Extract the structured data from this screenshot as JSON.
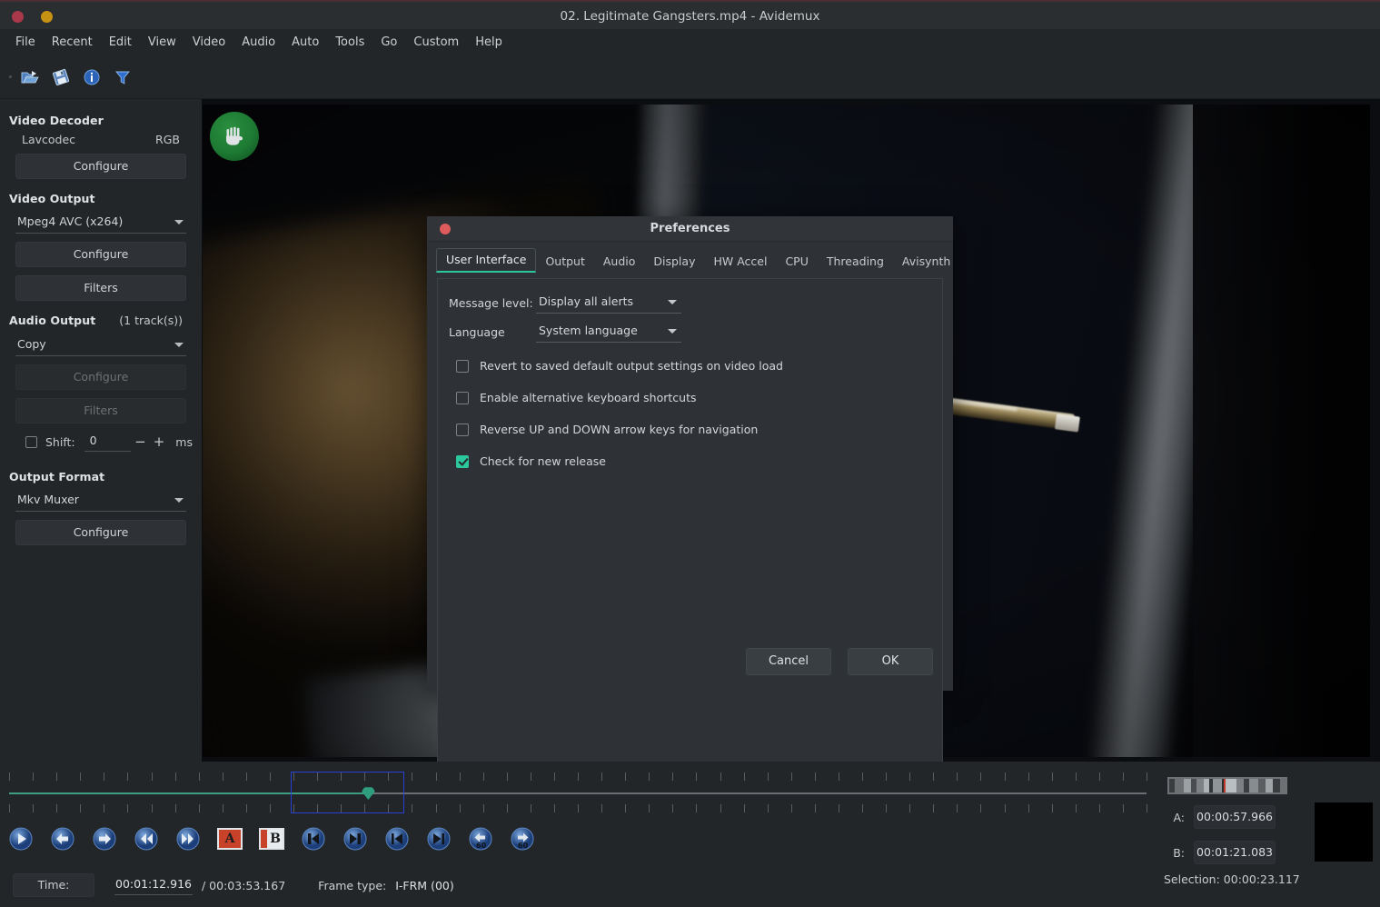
{
  "window": {
    "title": "02. Legitimate Gangsters.mp4 - Avidemux",
    "close_label": "close",
    "minimize_label": "minimize"
  },
  "menubar": {
    "items": [
      {
        "label": "File"
      },
      {
        "label": "Recent"
      },
      {
        "label": "Edit"
      },
      {
        "label": "View"
      },
      {
        "label": "Video"
      },
      {
        "label": "Audio"
      },
      {
        "label": "Auto"
      },
      {
        "label": "Tools"
      },
      {
        "label": "Go"
      },
      {
        "label": "Custom"
      },
      {
        "label": "Help"
      }
    ]
  },
  "toolbar": {
    "items": [
      {
        "icon": "open-file-icon"
      },
      {
        "icon": "save-file-icon"
      },
      {
        "icon": "info-icon"
      },
      {
        "icon": "filters-icon"
      }
    ]
  },
  "sidebar": {
    "video_decoder": {
      "title": "Video Decoder",
      "codec": "Lavcodec",
      "colorspace": "RGB",
      "configure_label": "Configure"
    },
    "video_output": {
      "title": "Video Output",
      "encoder": "Mpeg4 AVC (x264)",
      "configure_label": "Configure",
      "filters_label": "Filters"
    },
    "audio_output": {
      "title": "Audio Output",
      "tracks": "(1 track(s))",
      "codec": "Copy",
      "configure_label": "Configure",
      "filters_label": "Filters",
      "shift_label": "Shift:",
      "shift_value": "0",
      "shift_minus": "−",
      "shift_plus": "+",
      "shift_unit": "ms"
    },
    "output_format": {
      "title": "Output Format",
      "muxer": "Mkv Muxer",
      "configure_label": "Configure"
    }
  },
  "preferences": {
    "title": "Preferences",
    "tabs": [
      {
        "label": "User Interface",
        "active": true
      },
      {
        "label": "Output",
        "active": false
      },
      {
        "label": "Audio",
        "active": false
      },
      {
        "label": "Display",
        "active": false
      },
      {
        "label": "HW Accel",
        "active": false
      },
      {
        "label": "CPU",
        "active": false
      },
      {
        "label": "Threading",
        "active": false
      },
      {
        "label": "Avisynth",
        "active": false
      }
    ],
    "fields": {
      "message_level_label": "Message level:",
      "message_level_value": "Display all alerts",
      "language_label": "Language",
      "language_value": "System language"
    },
    "checkboxes": [
      {
        "label": "Revert to saved default output settings on video load",
        "checked": false
      },
      {
        "label": "Enable alternative keyboard shortcuts",
        "checked": false
      },
      {
        "label": "Reverse UP and DOWN arrow keys for navigation",
        "checked": false
      },
      {
        "label": "Check for new release",
        "checked": true
      }
    ],
    "cancel_label": "Cancel",
    "ok_label": "OK",
    "accent_color": "#2bc89d"
  },
  "transport": {
    "buttons": [
      {
        "icon": "play-icon",
        "name": "play-button"
      },
      {
        "icon": "arrow-left-icon",
        "name": "previous-frame-button"
      },
      {
        "icon": "arrow-right-icon",
        "name": "next-frame-button"
      },
      {
        "icon": "rewind-icon",
        "name": "rewind-button"
      },
      {
        "icon": "fast-forward-icon",
        "name": "forward-button"
      },
      {
        "icon": "marker-a-icon",
        "name": "set-marker-a-button"
      },
      {
        "icon": "marker-b-icon",
        "name": "set-marker-b-button"
      },
      {
        "icon": "prev-keyframe-icon",
        "name": "previous-keyframe-button"
      },
      {
        "icon": "next-keyframe-icon",
        "name": "next-keyframe-button"
      },
      {
        "icon": "go-start-icon",
        "name": "go-to-start-button"
      },
      {
        "icon": "go-end-icon",
        "name": "go-to-end-button"
      },
      {
        "icon": "back-60-icon",
        "name": "back-60-seconds-button"
      },
      {
        "icon": "forward-60-icon",
        "name": "forward-60-seconds-button"
      }
    ]
  },
  "statusbar": {
    "time_label": "Time:",
    "current_time": "00:01:12.916",
    "total_time": "/ 00:03:53.167",
    "frame_type_label": "Frame type:",
    "frame_type_value": "I-FRM (00)"
  },
  "markers": {
    "a_label": "A:",
    "a_value": "00:00:57.966",
    "b_label": "B:",
    "b_value": "00:01:21.083",
    "selection": "Selection: 00:00:23.117"
  }
}
